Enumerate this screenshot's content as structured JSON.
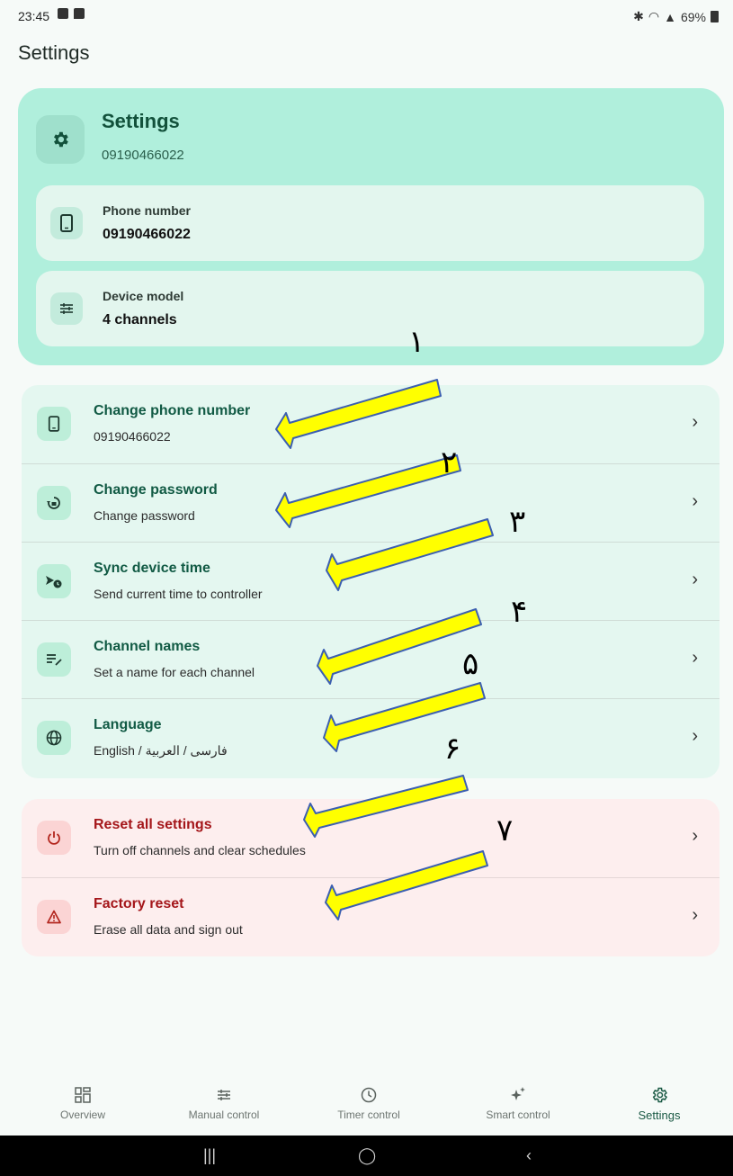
{
  "status": {
    "time": "23:45",
    "battery": "69%"
  },
  "page_title": "Settings",
  "header": {
    "title": "Settings",
    "subtitle": "09190466022",
    "phone": {
      "label": "Phone number",
      "value": "09190466022"
    },
    "device": {
      "label": "Device model",
      "value": "4 channels"
    }
  },
  "settings_list": [
    {
      "title": "Change phone number",
      "subtitle": "09190466022",
      "icon": "phone-icon"
    },
    {
      "title": "Change password",
      "subtitle": "Change password",
      "icon": "lock-reset-icon"
    },
    {
      "title": "Sync device time",
      "subtitle": "Send current time to controller",
      "icon": "send-clock-icon"
    },
    {
      "title": "Channel names",
      "subtitle": "Set a name for each channel",
      "icon": "edit-list-icon"
    },
    {
      "title": "Language",
      "subtitle": "English / فارسی / العربية",
      "icon": "globe-icon"
    }
  ],
  "danger_list": [
    {
      "title": "Reset all settings",
      "subtitle": "Turn off channels and clear schedules",
      "icon": "power-icon"
    },
    {
      "title": "Factory reset",
      "subtitle": "Erase all data and sign out",
      "icon": "warning-icon"
    }
  ],
  "annotations": [
    "١",
    "٢",
    "٣",
    "۴",
    "۵",
    "۶",
    "٧"
  ],
  "bottom_nav": [
    {
      "label": "Overview",
      "icon": "grid-icon"
    },
    {
      "label": "Manual control",
      "icon": "sliders-icon"
    },
    {
      "label": "Timer control",
      "icon": "clock-icon"
    },
    {
      "label": "Smart control",
      "icon": "sparkle-icon"
    },
    {
      "label": "Settings",
      "icon": "gear-icon",
      "active": true
    }
  ],
  "colors": {
    "accent": "#12513b",
    "header_bg": "#b0efdc",
    "danger": "#a4161a",
    "arrow_fill": "#ffff00"
  }
}
